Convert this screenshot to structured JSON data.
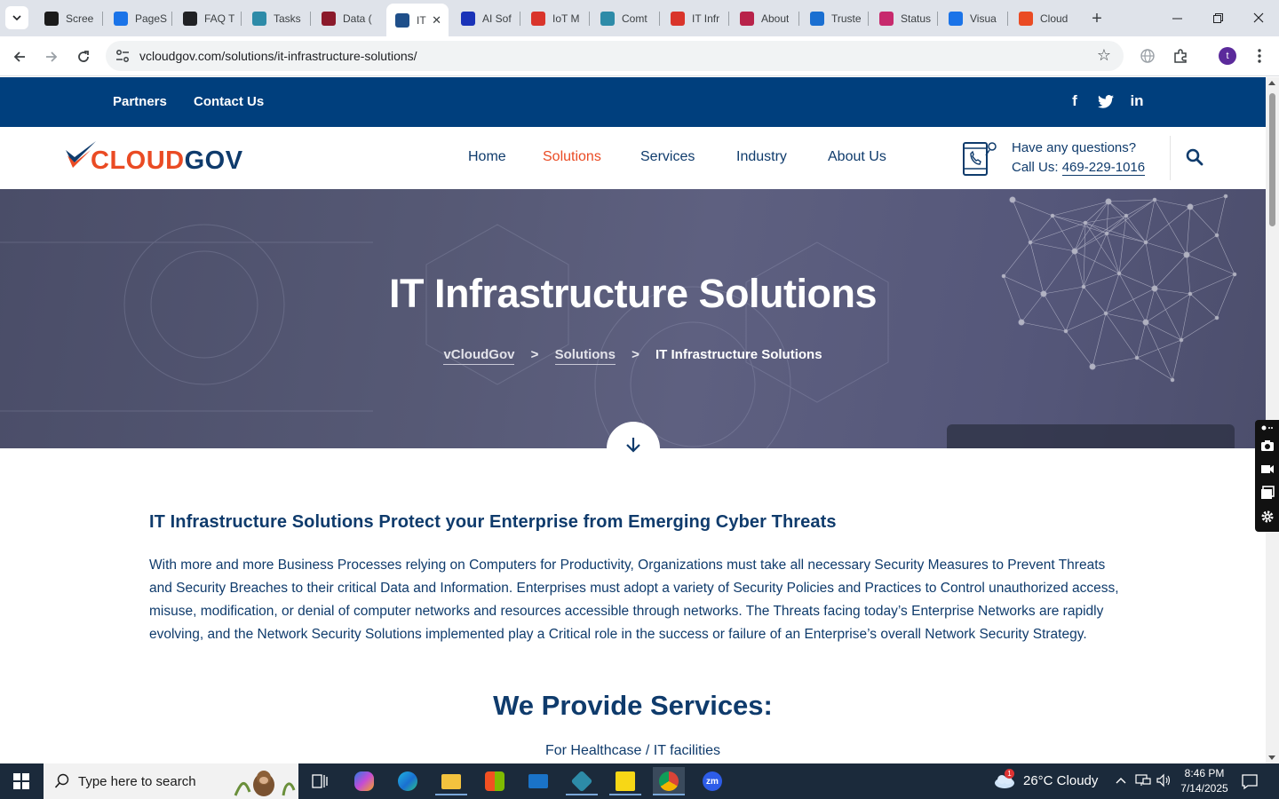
{
  "browser": {
    "tabs": [
      {
        "label": "Scree",
        "color": "#1b1b1b"
      },
      {
        "label": "PageS",
        "color": "#1a73e8"
      },
      {
        "label": "FAQ T",
        "color": "#202124"
      },
      {
        "label": "Tasks",
        "color": "#2d8ba8"
      },
      {
        "label": "Data (",
        "color": "#8b1a2b"
      },
      {
        "label": "IT",
        "color": "#1f4f8a"
      },
      {
        "label": "AI Sof",
        "color": "#1a33b8"
      },
      {
        "label": "IoT M",
        "color": "#d9342b"
      },
      {
        "label": "Comt",
        "color": "#2d8ba8"
      },
      {
        "label": "IT Infr",
        "color": "#d9342b"
      },
      {
        "label": "About",
        "color": "#b8234a"
      },
      {
        "label": "Truste",
        "color": "#1a6fd1"
      },
      {
        "label": "Status",
        "color": "#c72a6d"
      },
      {
        "label": "Visua",
        "color": "#1a73e8"
      },
      {
        "label": "Cloud",
        "color": "#ea4b24"
      }
    ],
    "active_tab_close": "✕",
    "new_tab": "+",
    "url": "vcloudgov.com/solutions/it-infrastructure-solutions/",
    "profile_initial": "t"
  },
  "topbar": {
    "links": [
      "Partners",
      "Contact Us"
    ],
    "social": {
      "facebook": "f",
      "twitter": "twitter",
      "linkedin": "in"
    }
  },
  "header": {
    "logo_part1": "CLOUD",
    "logo_part2": "GOV",
    "nav": [
      "Home",
      "Solutions",
      "Services",
      "Industry",
      "About Us"
    ],
    "active_nav": "Solutions",
    "question": "Have any questions?",
    "call_label": "Call Us: ",
    "phone": "469-229-1016"
  },
  "hero": {
    "title": "IT Infrastructure Solutions",
    "breadcrumb": [
      "vCloudGov",
      "Solutions",
      "IT Infrastructure Solutions"
    ],
    "separator": ">"
  },
  "content": {
    "heading": "IT Infrastructure Solutions Protect your Enterprise from Emerging Cyber Threats",
    "paragraph": "With more and more Business Processes relying on Computers for Productivity, Organizations must take all necessary Security Measures to Prevent Threats and Security Breaches to their critical Data and Information. Enterprises must adopt a variety of Security Policies and Practices to Control unauthorized access, misuse, modification, or denial of computer networks and resources accessible through networks. The Threats facing today’s Enterprise Networks are rapidly evolving, and the Network Security Solutions implemented play a Critical role in the success or failure of an Enterprise’s overall Network Security Strategy.",
    "services_heading": "We Provide Services:",
    "services_sub": "For Healthcase / IT facilities"
  },
  "taskbar": {
    "search_placeholder": "Type here to search",
    "weather": "26°C  Cloudy",
    "weather_badge": "1",
    "time": "8:46 PM",
    "date": "7/14/2025"
  }
}
